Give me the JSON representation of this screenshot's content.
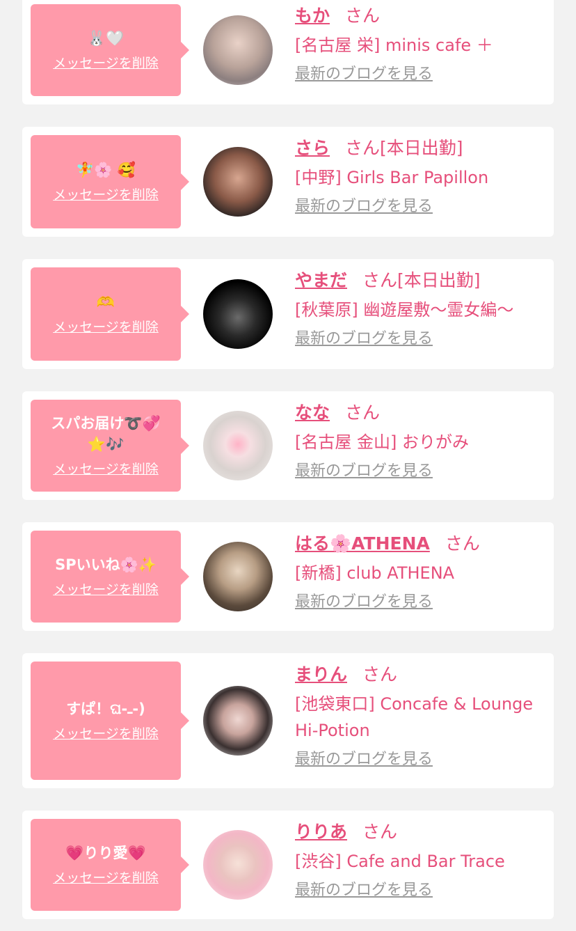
{
  "common": {
    "delete_label": "メッセージを削除",
    "blog_label": "最新のブログを見る",
    "san": "さん"
  },
  "items": [
    {
      "name": "もか",
      "status": "",
      "shop": "[名古屋 栄] minis cafe ＋",
      "message": "🐰🤍"
    },
    {
      "name": "さら",
      "status": "[本日出勤]",
      "shop": "[中野] Girls Bar Papillon",
      "message": "🧚🌸 🥰"
    },
    {
      "name": "やまだ",
      "status": "[本日出勤]",
      "shop": "[秋葉原] 幽遊屋敷〜霊女編〜",
      "message": "🫶"
    },
    {
      "name": "なな",
      "status": "",
      "shop": "[名古屋 金山] おりがみ",
      "message": "スパお届け➰💞⭐️🎶"
    },
    {
      "name": "はる🌸ATHENA",
      "status": "",
      "shop": "[新橋] club ATHENA",
      "message": "SPいいね🌸✨"
    },
    {
      "name": "まりん",
      "status": "",
      "shop": "[池袋東口] Concafe & Lounge Hi-Potion",
      "message": "すぱ！ଘ-ـ-)"
    },
    {
      "name": "りりあ",
      "status": "",
      "shop": "[渋谷] Cafe and Bar Trace",
      "message": "💗りり愛💗"
    }
  ],
  "colors": {
    "accent": "#e64f7b",
    "bubble": "#ff9aaa",
    "background": "#f2f2f2",
    "link_gray": "#999999"
  }
}
